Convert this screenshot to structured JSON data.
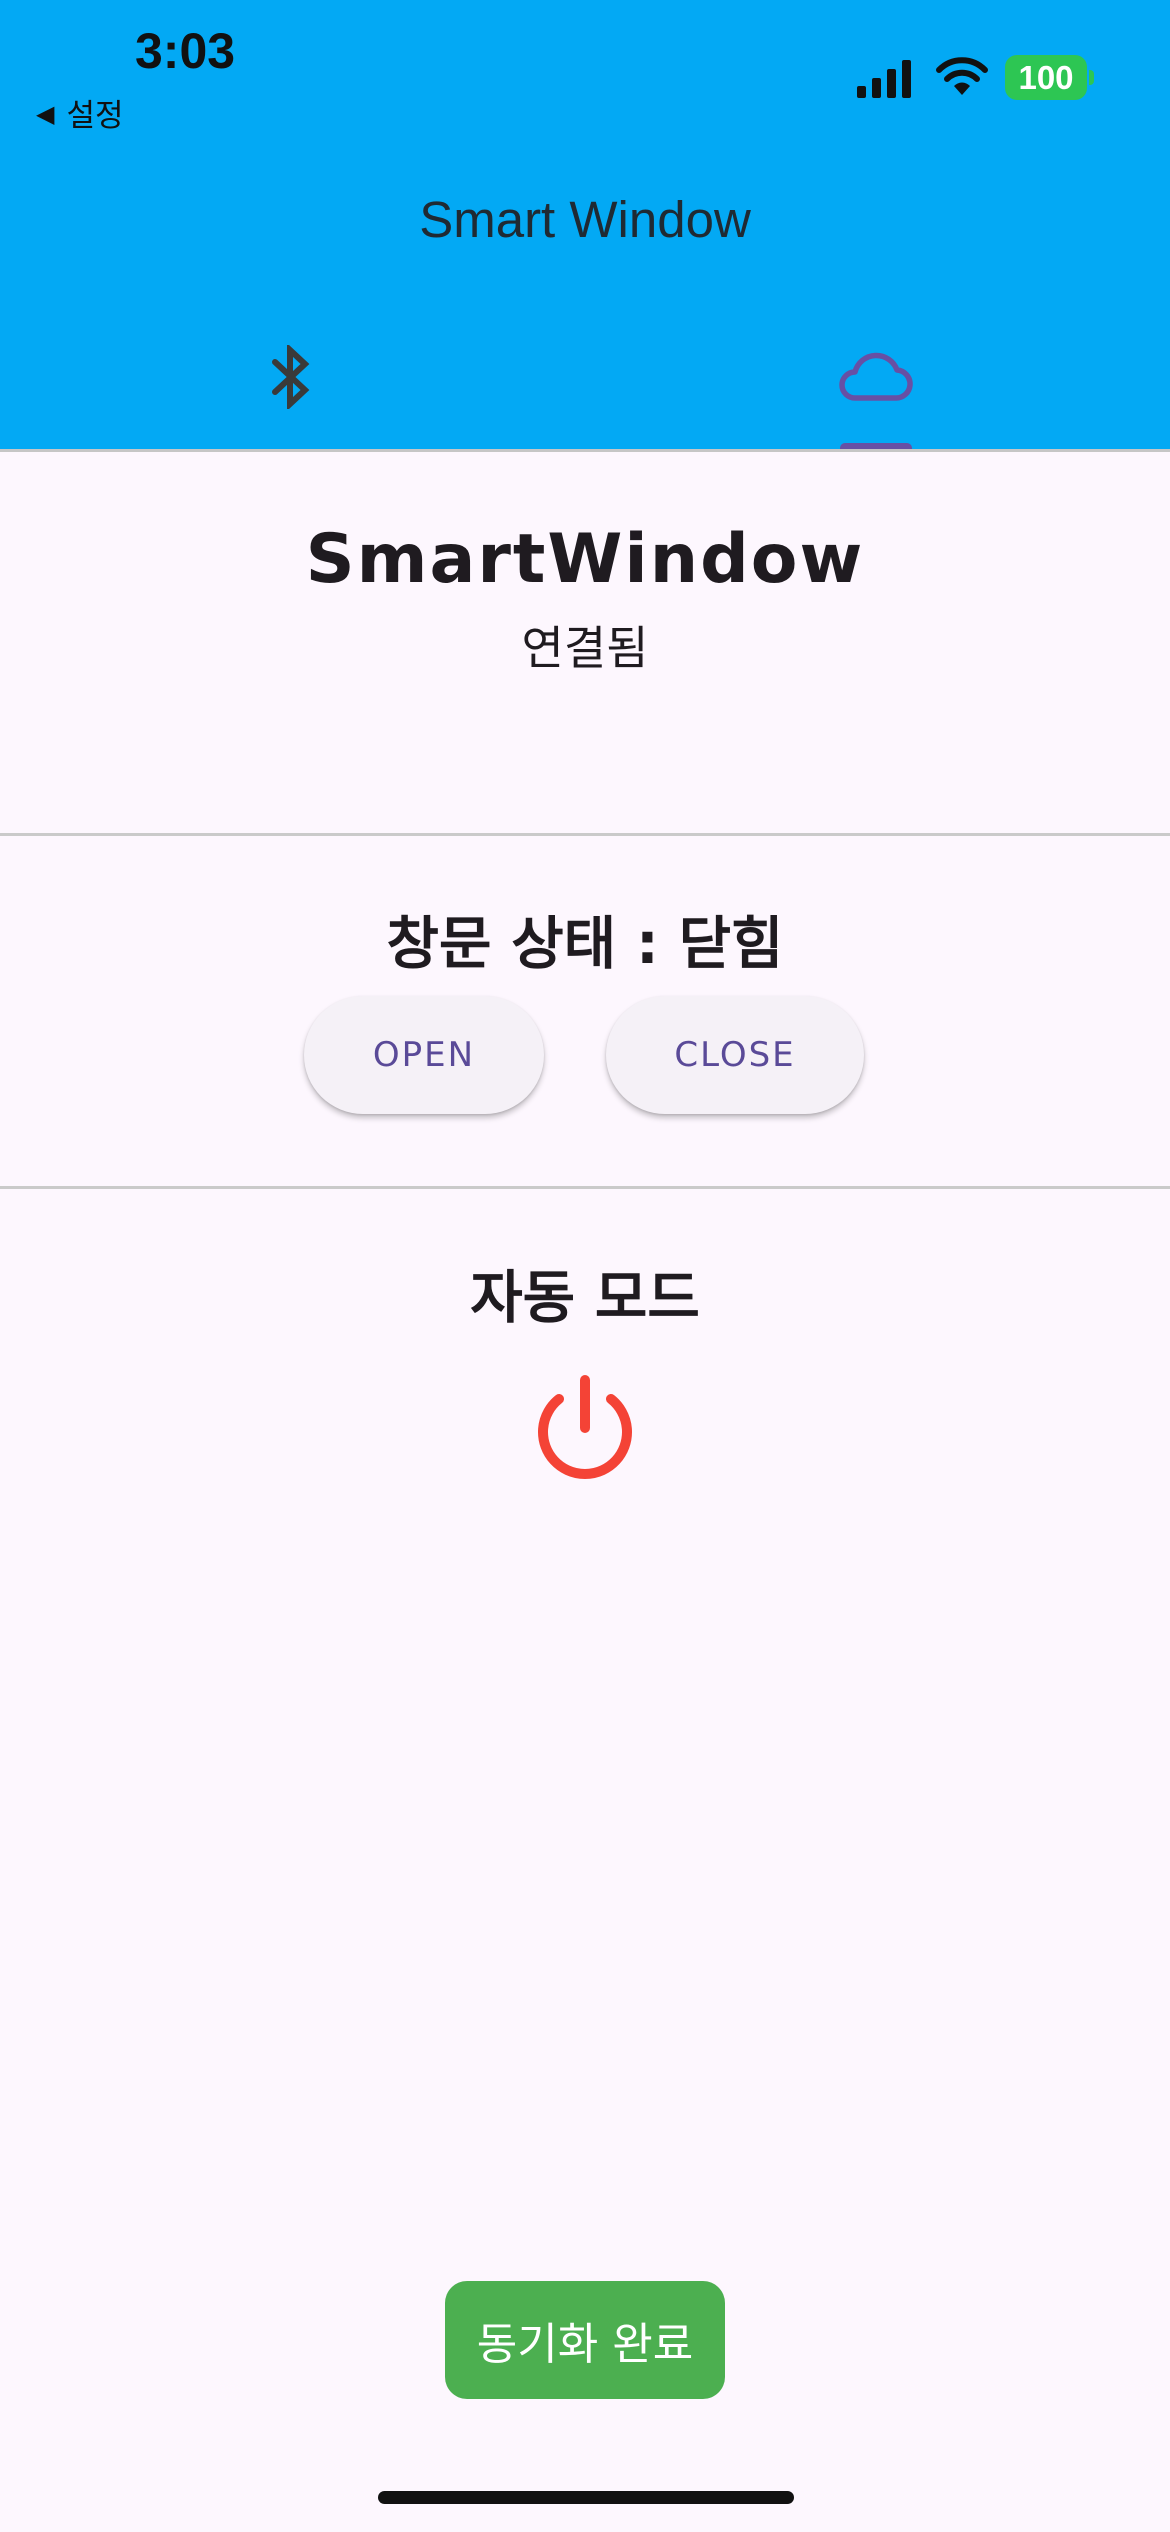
{
  "status_bar": {
    "time": "3:03",
    "back_label": "설정",
    "battery": "100",
    "icons": [
      "signal-icon",
      "wifi-icon",
      "battery-icon"
    ]
  },
  "app_bar": {
    "title": "Smart Window",
    "tabs": [
      {
        "icon": "bluetooth-icon",
        "selected": false
      },
      {
        "icon": "cloud-icon",
        "selected": true
      }
    ]
  },
  "device": {
    "name": "SmartWindow",
    "status": "연결됨"
  },
  "window": {
    "status_text": "창문 상태 : 닫힘",
    "open_label": "OPEN",
    "close_label": "CLOSE"
  },
  "auto_mode": {
    "label": "자동 모드",
    "icon": "power-icon",
    "enabled": false
  },
  "snackbar": {
    "message": "동기화 완료"
  },
  "colors": {
    "app_bar": "#03A9F4",
    "background": "#FDF7FE",
    "accent": "#6750A4",
    "power_off": "#F44336",
    "snackbar": "#4CAF50",
    "battery": "#2DC653"
  }
}
